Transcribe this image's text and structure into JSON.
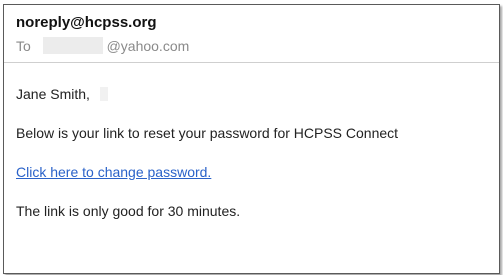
{
  "email": {
    "sender": "noreply@hcpss.org",
    "to_label": "To",
    "to_domain": "@yahoo.com",
    "greeting": "Jane Smith,",
    "body_text": "Below is your link to reset your password for HCPSS Connect",
    "link_text": "Click here to change password.",
    "expiry_text": "The link is only good for 30 minutes."
  },
  "colors": {
    "link": "#2a62c9",
    "muted": "#8a8a8a",
    "border": "#5a5a5a"
  }
}
